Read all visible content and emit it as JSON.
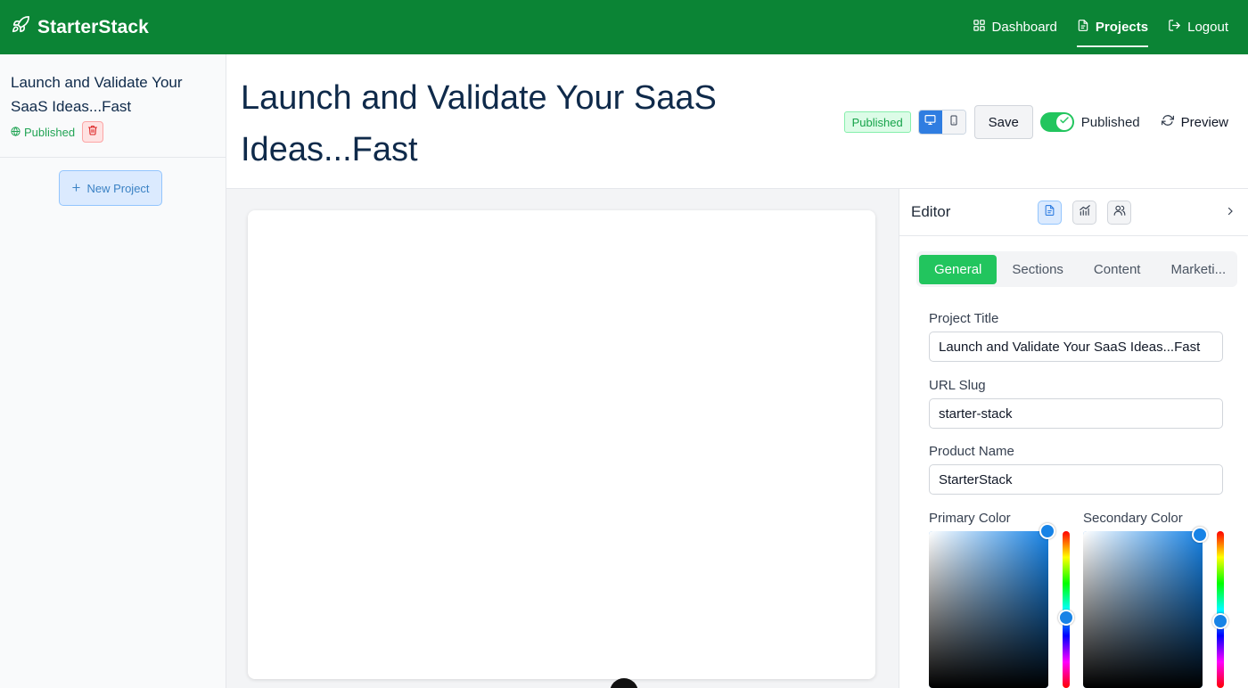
{
  "app": {
    "name": "StarterStack"
  },
  "nav": {
    "items": [
      {
        "label": "Dashboard",
        "icon": "dashboard-grid-icon"
      },
      {
        "label": "Projects",
        "icon": "document-icon",
        "active": true
      },
      {
        "label": "Logout",
        "icon": "logout-icon"
      }
    ]
  },
  "sidebar": {
    "project": {
      "title": "Launch and Validate Your SaaS Ideas...Fast",
      "status": "Published"
    },
    "new_project_label": "New Project"
  },
  "header": {
    "title": "Launch and Validate Your SaaS Ideas...Fast",
    "badge": "Published",
    "save_label": "Save",
    "toggle_label": "Published",
    "toggle_on": true,
    "preview_label": "Preview"
  },
  "editor": {
    "title": "Editor",
    "tabs": [
      "General",
      "Sections",
      "Content",
      "Marketi..."
    ],
    "active_tab": "General",
    "fields": {
      "project_title": {
        "label": "Project Title",
        "value": "Launch and Validate Your SaaS Ideas...Fast"
      },
      "url_slug": {
        "label": "URL Slug",
        "value": "starter-stack"
      },
      "product_name": {
        "label": "Product Name",
        "value": "StarterStack"
      }
    },
    "colors": {
      "primary": {
        "label": "Primary Color",
        "hue_color": "#1783e6"
      },
      "secondary": {
        "label": "Secondary Color",
        "hue_color": "#1783e6"
      }
    }
  },
  "theme": {
    "nav_bg": "#0b8435",
    "accent_green": "#22c55e",
    "accent_blue": "#2f7de1"
  }
}
